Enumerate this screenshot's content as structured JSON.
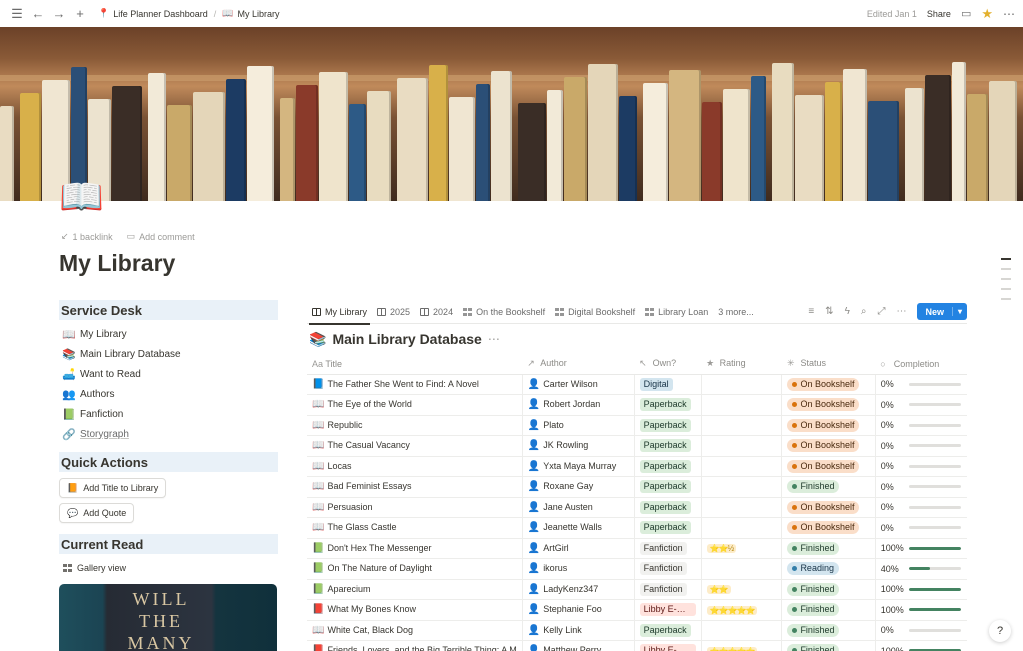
{
  "topbar": {
    "breadcrumbs": [
      {
        "icon": "pin-icon",
        "glyph": "📍",
        "label": "Life Planner Dashboard"
      },
      {
        "icon": "book-icon",
        "glyph": "📖",
        "label": "My Library"
      }
    ],
    "edited": "Edited Jan 1",
    "share": "Share"
  },
  "page": {
    "icon": "📖",
    "backlink": "1 backlink",
    "add_comment": "Add comment",
    "title": "My Library"
  },
  "left": {
    "service_desk": {
      "heading": "Service Desk",
      "items": [
        {
          "icon": "📖",
          "label": "My Library"
        },
        {
          "icon": "📚",
          "label": "Main Library Database"
        },
        {
          "icon": "🛋️",
          "label": "Want to Read"
        },
        {
          "icon": "👥",
          "label": "Authors"
        },
        {
          "icon": "📗",
          "label": "Fanfiction"
        },
        {
          "icon": "🔗",
          "label": "Storygraph"
        }
      ]
    },
    "quick_actions": {
      "heading": "Quick Actions",
      "buttons": [
        {
          "icon": "📙",
          "label": "Add Title to Library"
        },
        {
          "icon": "💬",
          "label": "Add Quote"
        }
      ]
    },
    "current_read": {
      "heading": "Current Read",
      "view": "Gallery view",
      "cover_text": "WILL THE MANY"
    }
  },
  "database": {
    "tabs": [
      {
        "label": "My Library",
        "kind": "table",
        "active": true
      },
      {
        "label": "2025",
        "kind": "table"
      },
      {
        "label": "2024",
        "kind": "table"
      },
      {
        "label": "On the Bookshelf",
        "kind": "gallery"
      },
      {
        "label": "Digital Bookshelf",
        "kind": "gallery"
      },
      {
        "label": "Library Loan",
        "kind": "gallery"
      },
      {
        "label": "3 more...",
        "kind": "more"
      }
    ],
    "new_label": "New",
    "title": "Main Library Database",
    "columns": {
      "title": "Title",
      "author": "Author",
      "own": "Own?",
      "rating": "Rating",
      "status": "Status",
      "completion": "Completion"
    },
    "rows": [
      {
        "icon": "📘",
        "title": "The Father She Went to Find: A Novel",
        "author": "Carter Wilson",
        "own": "Digital",
        "own_kind": "digital",
        "rating": "",
        "status": "On Bookshelf",
        "status_kind": "on",
        "completion": 0,
        "completion_label": "0%"
      },
      {
        "icon": "📖",
        "title": "The Eye of the World",
        "author": "Robert Jordan",
        "own": "Paperback",
        "own_kind": "paperback",
        "rating": "",
        "status": "On Bookshelf",
        "status_kind": "on",
        "completion": 0,
        "completion_label": "0%"
      },
      {
        "icon": "📖",
        "title": "Republic",
        "author": "Plato",
        "own": "Paperback",
        "own_kind": "paperback",
        "rating": "",
        "status": "On Bookshelf",
        "status_kind": "on",
        "completion": 0,
        "completion_label": "0%"
      },
      {
        "icon": "📖",
        "title": "The Casual Vacancy",
        "author": "JK Rowling",
        "own": "Paperback",
        "own_kind": "paperback",
        "rating": "",
        "status": "On Bookshelf",
        "status_kind": "on",
        "completion": 0,
        "completion_label": "0%"
      },
      {
        "icon": "📖",
        "title": "Locas",
        "author": "Yxta Maya Murray",
        "own": "Paperback",
        "own_kind": "paperback",
        "rating": "",
        "status": "On Bookshelf",
        "status_kind": "on",
        "completion": 0,
        "completion_label": "0%"
      },
      {
        "icon": "📖",
        "title": "Bad Feminist Essays",
        "author": "Roxane Gay",
        "own": "Paperback",
        "own_kind": "paperback",
        "rating": "",
        "status": "Finished",
        "status_kind": "fin",
        "completion": 0,
        "completion_label": "0%"
      },
      {
        "icon": "📖",
        "title": "Persuasion",
        "author": "Jane Austen",
        "own": "Paperback",
        "own_kind": "paperback",
        "rating": "",
        "status": "On Bookshelf",
        "status_kind": "on",
        "completion": 0,
        "completion_label": "0%"
      },
      {
        "icon": "📖",
        "title": "The Glass Castle",
        "author": "Jeanette Walls",
        "own": "Paperback",
        "own_kind": "paperback",
        "rating": "",
        "status": "On Bookshelf",
        "status_kind": "on",
        "completion": 0,
        "completion_label": "0%"
      },
      {
        "icon": "📗",
        "title": "Don't Hex The Messenger",
        "author": "ArtGirl",
        "own": "Fanfiction",
        "own_kind": "fanfiction",
        "rating": "⭐⭐½",
        "status": "Finished",
        "status_kind": "fin",
        "completion": 100,
        "completion_label": "100%"
      },
      {
        "icon": "📗",
        "title": "On The Nature of Daylight",
        "author": "ikorus",
        "own": "Fanfiction",
        "own_kind": "fanfiction",
        "rating": "",
        "status": "Reading",
        "status_kind": "read",
        "completion": 40,
        "completion_label": "40%"
      },
      {
        "icon": "📗",
        "title": "Aparecium",
        "author": "LadyKenz347",
        "own": "Fanfiction",
        "own_kind": "fanfiction",
        "rating": "⭐⭐",
        "status": "Finished",
        "status_kind": "fin",
        "completion": 100,
        "completion_label": "100%"
      },
      {
        "icon": "📕",
        "title": "What My Bones Know",
        "author": "Stephanie Foo",
        "own": "Libby E-Bo...",
        "own_kind": "libby",
        "rating": "⭐⭐⭐⭐⭐",
        "status": "Finished",
        "status_kind": "fin",
        "completion": 100,
        "completion_label": "100%"
      },
      {
        "icon": "📖",
        "title": "White Cat, Black Dog",
        "author": "Kelly Link",
        "own": "Paperback",
        "own_kind": "paperback",
        "rating": "",
        "status": "Finished",
        "status_kind": "fin",
        "completion": 0,
        "completion_label": "0%"
      },
      {
        "icon": "📕",
        "title": "Friends, Lovers, and the Big Terrible Thing: A M",
        "author": "Matthew Perry",
        "own": "Libby E-Bo...",
        "own_kind": "libby",
        "rating": "⭐⭐⭐⭐⭐",
        "status": "Finished",
        "status_kind": "fin",
        "completion": 100,
        "completion_label": "100%"
      }
    ]
  },
  "colors": {
    "accent": "#2383e2",
    "section_bg": "#e9f1f8",
    "on_bookshelf": "#fadec9",
    "finished": "#dbeddb",
    "reading": "#d3e5ef",
    "progress": "#448361"
  }
}
